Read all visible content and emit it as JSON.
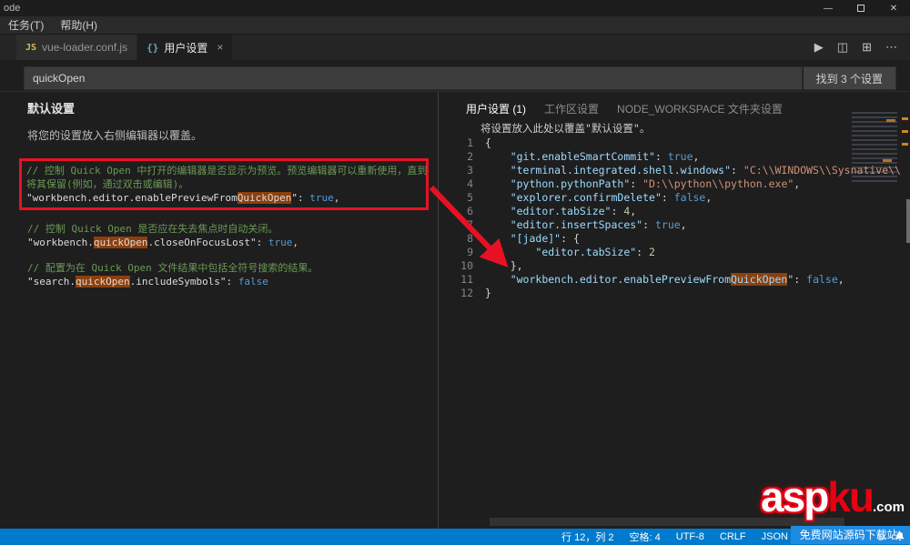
{
  "titlebar": {
    "title": "ode",
    "menus": [
      "任务(T)",
      "帮助(H)"
    ],
    "minimize": "—",
    "close": "✕"
  },
  "tabbar": {
    "tabs": [
      {
        "icon": "JS",
        "label": "vue-loader.conf.js"
      },
      {
        "icon": "{}",
        "label": "用户设置",
        "close": "×"
      }
    ],
    "actions": [
      {
        "name": "run-button",
        "glyph": "▶"
      },
      {
        "name": "split-editor-icon",
        "glyph": "◫"
      },
      {
        "name": "layout-icon",
        "glyph": "⊞"
      },
      {
        "name": "more-actions-icon",
        "glyph": "⋯"
      }
    ]
  },
  "searchbar": {
    "value": "quickOpen",
    "results": "找到 3 个设置"
  },
  "left_pane": {
    "header": "默认设置",
    "note": "将您的设置放入右侧编辑器以覆盖。",
    "blocks": [
      {
        "boxed": true,
        "lines": [
          [
            {
              "t": "// 控制 Quick Open 中打开的编辑器是否显示为预览。预览编辑器可以重新使用，直到",
              "c": "cmt"
            }
          ],
          [
            {
              "t": "将其保留(例如，通过双击或编辑)。",
              "c": "cmt"
            }
          ],
          [
            {
              "t": "\"workbench.editor.enablePreviewFrom",
              "c": "lkey"
            },
            {
              "t": "QuickOpen",
              "c": "lkey hl"
            },
            {
              "t": "\": ",
              "c": "lkey"
            },
            {
              "t": "true",
              "c": "kw"
            },
            {
              "t": ",",
              "c": "pun"
            }
          ]
        ]
      },
      {
        "boxed": false,
        "lines": [
          [
            {
              "t": "// 控制 Quick Open 是否应在失去焦点时自动关闭。",
              "c": "cmt"
            }
          ],
          [
            {
              "t": "\"workbench.",
              "c": "lkey"
            },
            {
              "t": "quickOpen",
              "c": "lkey hl"
            },
            {
              "t": ".closeOnFocusLost\": ",
              "c": "lkey"
            },
            {
              "t": "true",
              "c": "kw"
            },
            {
              "t": ",",
              "c": "pun"
            }
          ]
        ]
      },
      {
        "boxed": false,
        "lines": [
          [
            {
              "t": "// 配置为在 Quick Open 文件结果中包括全符号搜索的结果。",
              "c": "cmt"
            }
          ],
          [
            {
              "t": "\"search.",
              "c": "lkey"
            },
            {
              "t": "quickOpen",
              "c": "lkey hl"
            },
            {
              "t": ".includeSymbols\": ",
              "c": "lkey"
            },
            {
              "t": "false",
              "c": "kw"
            }
          ]
        ]
      }
    ]
  },
  "right_pane": {
    "tabs": [
      {
        "label": "用户设置 (1)",
        "active": true
      },
      {
        "label": "工作区设置",
        "active": false
      },
      {
        "label": "NODE_WORKSPACE 文件夹设置",
        "active": false
      }
    ],
    "note": "将设置放入此处以覆盖\"默认设置\"。",
    "lines": [
      {
        "n": 1,
        "tokens": [
          {
            "t": "{",
            "c": "pun"
          }
        ]
      },
      {
        "n": 2,
        "tokens": [
          {
            "t": "    ",
            "c": "pun"
          },
          {
            "t": "\"git.enableSmartCommit\"",
            "c": "key"
          },
          {
            "t": ": ",
            "c": "pun"
          },
          {
            "t": "true",
            "c": "kw"
          },
          {
            "t": ",",
            "c": "pun"
          }
        ]
      },
      {
        "n": 3,
        "tokens": [
          {
            "t": "    ",
            "c": "pun"
          },
          {
            "t": "\"terminal.integrated.shell.windows\"",
            "c": "key"
          },
          {
            "t": ": ",
            "c": "pun"
          },
          {
            "t": "\"C:\\\\WINDOWS\\\\Sysnative\\\\",
            "c": "str"
          }
        ]
      },
      {
        "n": 4,
        "tokens": [
          {
            "t": "    ",
            "c": "pun"
          },
          {
            "t": "\"python.pythonPath\"",
            "c": "key"
          },
          {
            "t": ": ",
            "c": "pun"
          },
          {
            "t": "\"D:\\\\python\\\\python.exe\"",
            "c": "str"
          },
          {
            "t": ",",
            "c": "pun"
          }
        ]
      },
      {
        "n": 5,
        "tokens": [
          {
            "t": "    ",
            "c": "pun"
          },
          {
            "t": "\"explorer.confirmDelete\"",
            "c": "key"
          },
          {
            "t": ": ",
            "c": "pun"
          },
          {
            "t": "false",
            "c": "kw"
          },
          {
            "t": ",",
            "c": "pun"
          }
        ]
      },
      {
        "n": 6,
        "tokens": [
          {
            "t": "    ",
            "c": "pun"
          },
          {
            "t": "\"editor.tabSize\"",
            "c": "key"
          },
          {
            "t": ": ",
            "c": "pun"
          },
          {
            "t": "4",
            "c": "num"
          },
          {
            "t": ",",
            "c": "pun"
          }
        ]
      },
      {
        "n": 7,
        "tokens": [
          {
            "t": "    ",
            "c": "pun"
          },
          {
            "t": "\"editor.insertSpaces\"",
            "c": "key"
          },
          {
            "t": ": ",
            "c": "pun"
          },
          {
            "t": "true",
            "c": "kw"
          },
          {
            "t": ",",
            "c": "pun"
          }
        ]
      },
      {
        "n": 8,
        "tokens": [
          {
            "t": "    ",
            "c": "pun"
          },
          {
            "t": "\"[jade]\"",
            "c": "key"
          },
          {
            "t": ": {",
            "c": "pun"
          }
        ]
      },
      {
        "n": 9,
        "tokens": [
          {
            "t": "        ",
            "c": "pun"
          },
          {
            "t": "\"editor.tabSize\"",
            "c": "key"
          },
          {
            "t": ": ",
            "c": "pun"
          },
          {
            "t": "2",
            "c": "num"
          }
        ]
      },
      {
        "n": 10,
        "tokens": [
          {
            "t": "    },",
            "c": "pun"
          }
        ]
      },
      {
        "n": 11,
        "tokens": [
          {
            "t": "    ",
            "c": "pun"
          },
          {
            "t": "\"workbench.editor.enablePreviewFrom",
            "c": "key"
          },
          {
            "t": "QuickOpen",
            "c": "key hl"
          },
          {
            "t": "\"",
            "c": "key"
          },
          {
            "t": ": ",
            "c": "pun"
          },
          {
            "t": "false",
            "c": "kw"
          },
          {
            "t": ",",
            "c": "pun"
          }
        ]
      },
      {
        "n": 12,
        "tokens": [
          {
            "t": "}",
            "c": "pun"
          }
        ]
      }
    ]
  },
  "statusbar": {
    "items": [
      "行 12，列 2",
      "空格: 4",
      "UTF-8",
      "CRLF",
      "JSON"
    ]
  },
  "watermark": {
    "asp": "asp",
    "ku": "ku",
    "com": ".com",
    "banner": "免费网站源码下载站!"
  }
}
